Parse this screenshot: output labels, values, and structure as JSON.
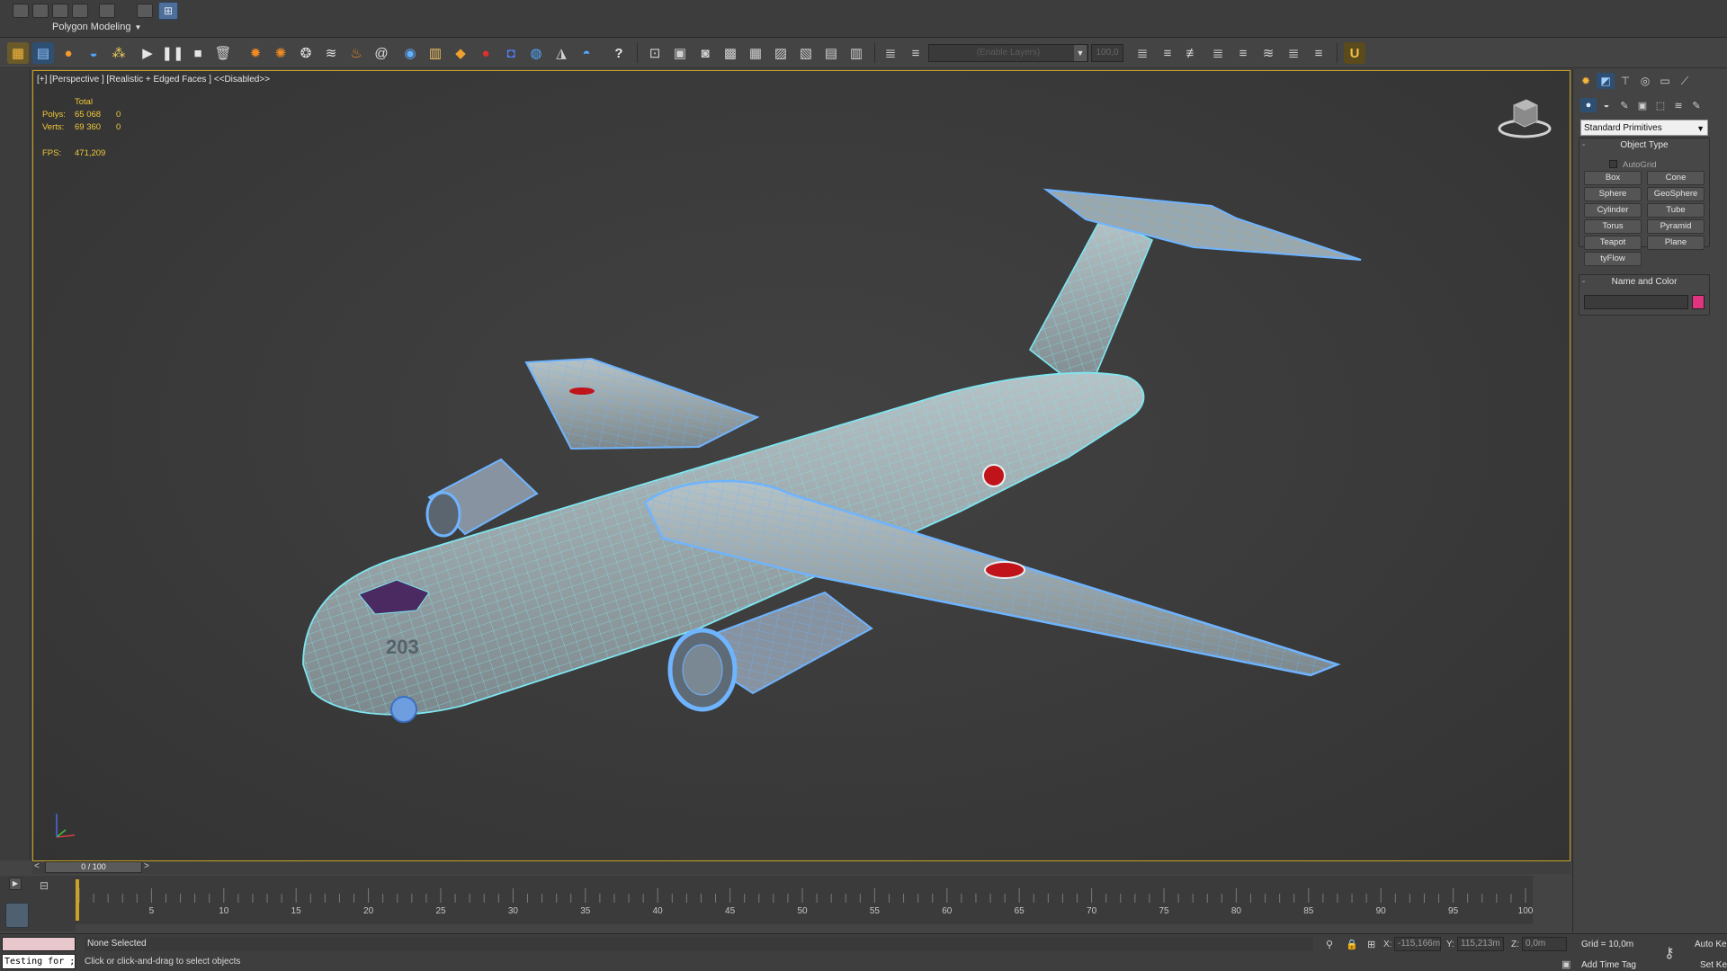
{
  "workspace": {
    "menu_label": "Polygon Modeling"
  },
  "toolbar": {
    "layer_placeholder": "(Enable Layers)",
    "spinner_value": "100,0"
  },
  "viewport": {
    "label": "[+] [Perspective ] [Realistic + Edged Faces ] <<Disabled>>",
    "stats": {
      "header": "Total",
      "polys_label": "Polys:",
      "polys_total": "65 068",
      "polys_sel": "0",
      "verts_label": "Verts:",
      "verts_total": "69 360",
      "verts_sel": "0",
      "fps_label": "FPS:",
      "fps_value": "471,209"
    },
    "model": {
      "fuselage_marking": "203",
      "wireframe_color": "#7ee6f0",
      "hinomaru_color": "#c0141a"
    }
  },
  "command_panel": {
    "primitive_category": "Standard Primitives",
    "object_type_header": "Object Type",
    "autogrid_label": "AutoGrid",
    "buttons": [
      "Box",
      "Cone",
      "Sphere",
      "GeoSphere",
      "Cylinder",
      "Tube",
      "Torus",
      "Pyramid",
      "Teapot",
      "Plane",
      "tyFlow"
    ],
    "name_color_header": "Name and Color",
    "object_color": "#e0357e"
  },
  "timeline": {
    "frame_display": "0 / 100",
    "prev_arrow": "<",
    "next_arrow": ">",
    "ticks": [
      "5",
      "10",
      "15",
      "20",
      "25",
      "30",
      "35",
      "40",
      "45",
      "50",
      "55",
      "60",
      "65",
      "70",
      "75",
      "80",
      "85",
      "90",
      "95",
      "100"
    ]
  },
  "status": {
    "maxscript_text": "Testing for ;",
    "selection": "None Selected",
    "prompt": "Click or click-and-drag to select objects",
    "x_label": "X:",
    "x_value": "-115,166m",
    "y_label": "Y:",
    "y_value": "115,213m",
    "z_label": "Z:",
    "z_value": "0,0m",
    "grid": "Grid = 10,0m",
    "add_time_tag": "Add Time Tag",
    "auto_key": "Auto Ke",
    "set_key": "Set Key"
  }
}
